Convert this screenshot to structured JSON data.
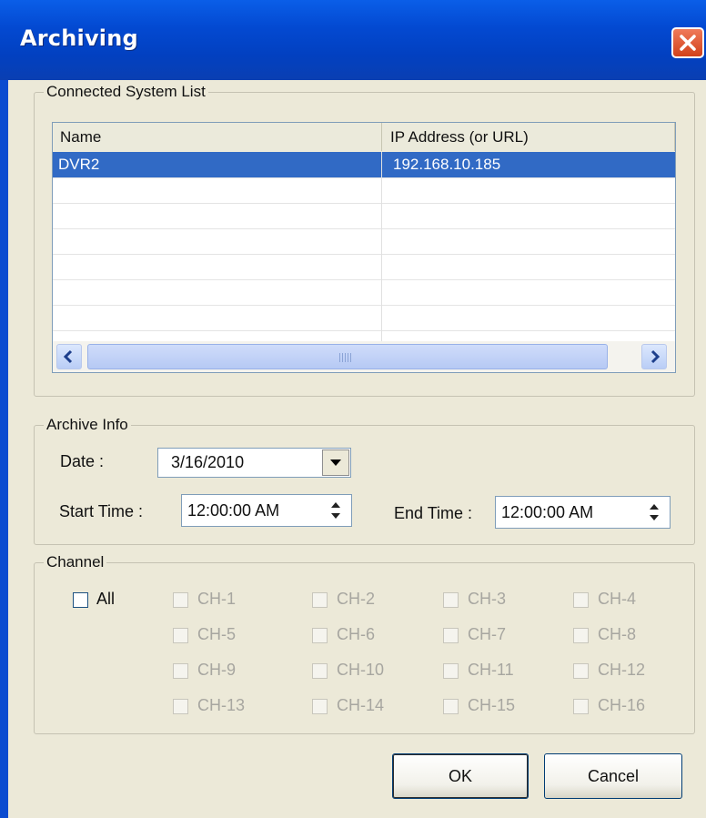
{
  "window": {
    "title": "Archiving"
  },
  "system_list": {
    "group_label": "Connected System List",
    "columns": [
      "Name",
      "IP Address (or URL)"
    ],
    "rows": [
      {
        "name": "DVR2",
        "ip": "192.168.10.185",
        "selected": true
      },
      {
        "name": "",
        "ip": "",
        "selected": false
      },
      {
        "name": "",
        "ip": "",
        "selected": false
      },
      {
        "name": "",
        "ip": "",
        "selected": false
      },
      {
        "name": "",
        "ip": "",
        "selected": false
      },
      {
        "name": "",
        "ip": "",
        "selected": false
      },
      {
        "name": "",
        "ip": "",
        "selected": false
      }
    ]
  },
  "archive_info": {
    "group_label": "Archive Info",
    "date_label": "Date :",
    "date_value": "3/16/2010",
    "start_label": "Start Time :",
    "start_value": "12:00:00 AM",
    "end_label": "End Time :",
    "end_value": "12:00:00 AM"
  },
  "channel": {
    "group_label": "Channel",
    "all_label": "All",
    "channels": [
      "CH-1",
      "CH-2",
      "CH-3",
      "CH-4",
      "CH-5",
      "CH-6",
      "CH-7",
      "CH-8",
      "CH-9",
      "CH-10",
      "CH-11",
      "CH-12",
      "CH-13",
      "CH-14",
      "CH-15",
      "CH-16"
    ]
  },
  "buttons": {
    "ok": "OK",
    "cancel": "Cancel"
  },
  "colors": {
    "titlebar": "#0349d1",
    "dialog_bg": "#ece9d8",
    "selection": "#316ac5"
  }
}
